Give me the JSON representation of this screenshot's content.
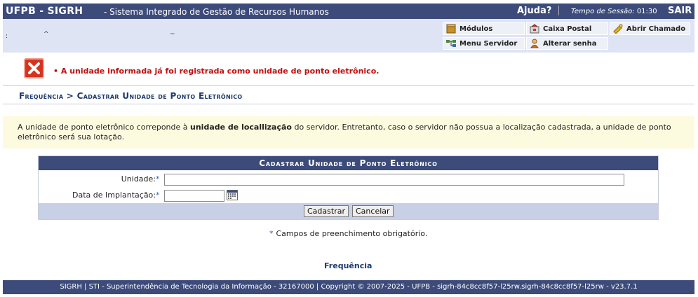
{
  "header": {
    "system": "UFPB - SIGRH",
    "system_description": "- Sistema Integrado de Gestão de Recursos Humanos",
    "help": "Ajuda?",
    "session_label": "Tempo de Sessão:",
    "session_time": "01:30",
    "logout": "SAIR"
  },
  "infobar": {
    "marks": [
      ":",
      "^",
      "~"
    ],
    "menu": [
      {
        "label": "Módulos",
        "icon": "modules-icon"
      },
      {
        "label": "Caixa Postal",
        "icon": "mailbox-icon"
      },
      {
        "label": "Abrir Chamado",
        "icon": "ticket-icon"
      },
      {
        "label": "Menu Servidor",
        "icon": "network-icon"
      },
      {
        "label": "Alterar senha",
        "icon": "user-key-icon"
      }
    ]
  },
  "error": {
    "message": "• A unidade informada já foi registrada como unidade de ponto eletrônico."
  },
  "breadcrumb": "Frequência > Cadastrar Unidade de Ponto Eletrônico",
  "notice": {
    "before": "A unidade de ponto eletrônico correponde à ",
    "bold": "unidade de locallização",
    "after": " do servidor. Entretanto, caso o servidor não possua a localização cadastrada, a unidade de ponto eletrônico será sua lotação."
  },
  "form": {
    "caption": "Cadastrar Unidade de Ponto Eletrônico",
    "unit_label": "Unidade:",
    "unit_value": "",
    "date_label": "Data de Implantação:",
    "date_value": "",
    "required_marker": "*",
    "submit": "Cadastrar",
    "cancel": "Cancelar"
  },
  "required_note": "Campos de preenchimento obrigatório.",
  "bottom_link": "Frequência",
  "footer": "SIGRH | STI - Superintendência de Tecnologia da Informação - 32167000 | Copyright © 2007-2025 - UFPB - sigrh-84c8cc8f57-l25rw.sigrh-84c8cc8f57-l25rw - v23.7.1",
  "colors": {
    "primary": "#3c4b7a",
    "infobar": "#dfe4f4",
    "error": "#c01010",
    "notice_bg": "#fdfbdf"
  }
}
